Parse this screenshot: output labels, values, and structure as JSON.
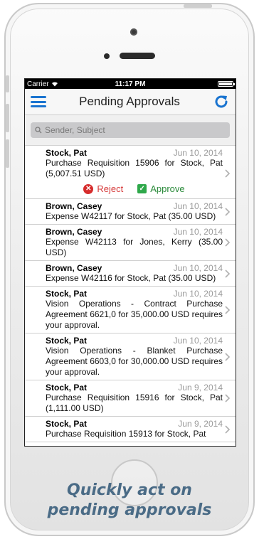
{
  "status_bar": {
    "carrier": "Carrier",
    "time": "11:17 PM"
  },
  "nav": {
    "title": "Pending Approvals"
  },
  "search": {
    "placeholder": "Sender, Subject"
  },
  "actions": {
    "reject_label": "Reject",
    "approve_label": "Approve"
  },
  "items": [
    {
      "sender": "Stock, Pat",
      "date": "Jun 10, 2014",
      "subject": "Purchase Requisition 15906 for Stock, Pat (5,007.51 USD)"
    },
    {
      "sender": "Brown, Casey",
      "date": "Jun 10, 2014",
      "subject": "Expense W42117 for Stock, Pat (35.00 USD)"
    },
    {
      "sender": "Brown, Casey",
      "date": "Jun 10, 2014",
      "subject": "Expense W42113 for Jones, Kerry (35.00 USD)"
    },
    {
      "sender": "Brown, Casey",
      "date": "Jun 10, 2014",
      "subject": "Expense W42116 for Stock, Pat (35.00 USD)"
    },
    {
      "sender": "Stock, Pat",
      "date": "Jun 10, 2014",
      "subject": "Vision Operations - Contract Purchase Agreement 6621,0 for 35,000.00 USD requires your approval."
    },
    {
      "sender": "Stock, Pat",
      "date": "Jun 10, 2014",
      "subject": "Vision Operations - Blanket Purchase Agreement 6603,0 for 30,000.00 USD requires your approval."
    },
    {
      "sender": "Stock, Pat",
      "date": "Jun 9, 2014",
      "subject": "Purchase Requisition 15916 for Stock, Pat (1,111.00 USD)"
    },
    {
      "sender": "Stock, Pat",
      "date": "Jun 9, 2014",
      "subject": "Purchase Requisition 15913 for Stock, Pat"
    }
  ],
  "caption": {
    "line1": "Quickly act on",
    "line2": "pending approvals"
  },
  "colors": {
    "accent": "#1a74d0",
    "reject": "#d62c2c",
    "approve": "#2ea84a",
    "caption": "#4a6b86"
  },
  "icons": {
    "menu": "hamburger-icon",
    "refresh": "refresh-icon",
    "search": "search-icon",
    "chevron": "chevron-right-icon"
  }
}
